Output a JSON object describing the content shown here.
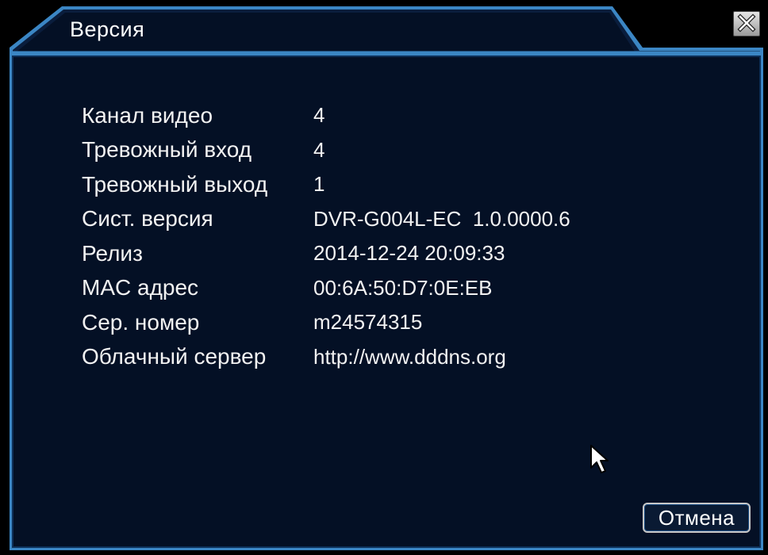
{
  "window": {
    "title": "Версия",
    "close_icon": "close-icon"
  },
  "info": {
    "rows": [
      {
        "label": "Канал видео",
        "value": "4"
      },
      {
        "label": "Тревожный вход",
        "value": "4"
      },
      {
        "label": "Тревожный выход",
        "value": "1"
      },
      {
        "label": "Сист. версия",
        "value": "DVR-G004L-EC  1.0.0000.6"
      },
      {
        "label": "Релиз",
        "value": "2014-12-24 20:09:33"
      },
      {
        "label": "MAC адрес",
        "value": "00:6A:50:D7:0E:EB"
      },
      {
        "label": "Сер. номер",
        "value": "m24574315"
      },
      {
        "label": "Облачный сервер",
        "value": "http://www.dddns.org"
      }
    ]
  },
  "footer": {
    "cancel_label": "Отмена"
  },
  "colors": {
    "panel_background": "#041025",
    "border_accent": "#3b86c4",
    "text": "#f2f2f2"
  }
}
